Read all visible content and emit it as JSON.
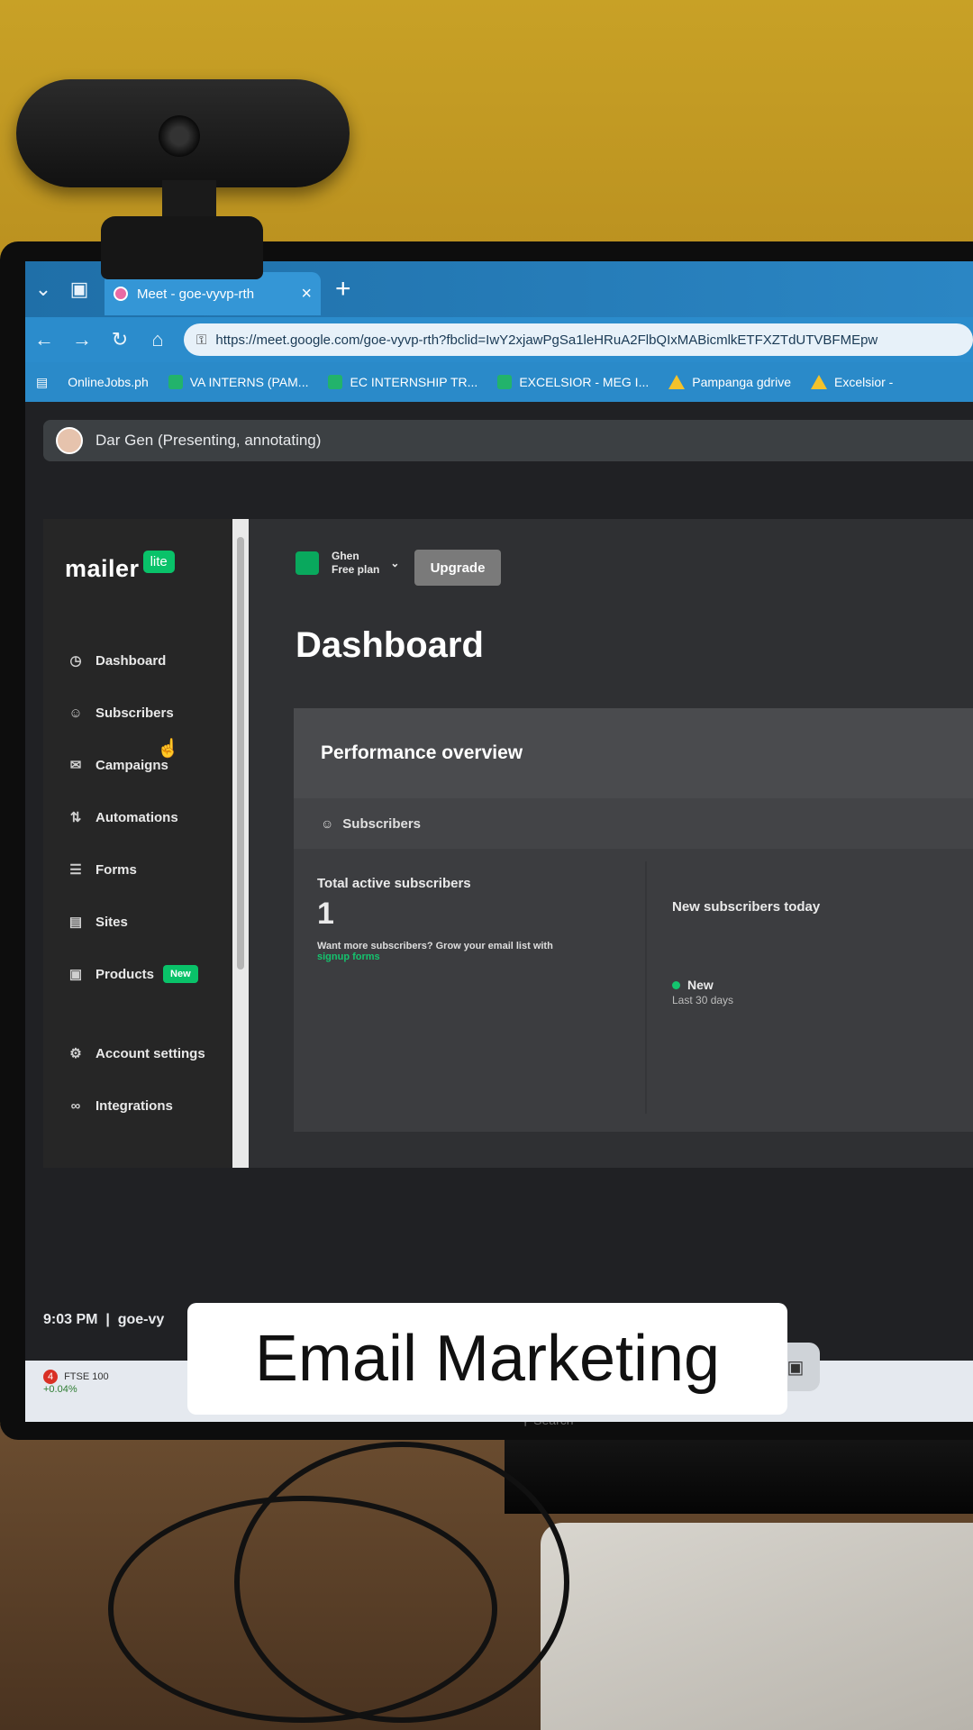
{
  "browser": {
    "tab_title": "Meet - goe-vyvp-rth",
    "url": "https://meet.google.com/goe-vyvp-rth?fbclid=IwY2xjawPgSa1leHRuA2FlbQIxMABicmlkETFXZTdUTVBFMEpw",
    "bookmarks": [
      "OnlineJobs.ph",
      "VA INTERNS (PAM...",
      "EC INTERNSHIP TR...",
      "EXCELSIOR - MEG I...",
      "Pampanga gdrive",
      "Excelsior -"
    ]
  },
  "meet": {
    "presenter": "Dar Gen (Presenting, annotating)",
    "time": "9:03 PM",
    "code": "goe-vy"
  },
  "app": {
    "logo_word": "mailer",
    "logo_badge": "lite",
    "account_name": "Ghen",
    "account_plan": "Free plan",
    "upgrade_label": "Upgrade",
    "page_title": "Dashboard",
    "nav": [
      {
        "label": "Dashboard",
        "icon": "clock-icon"
      },
      {
        "label": "Subscribers",
        "icon": "person-icon"
      },
      {
        "label": "Campaigns",
        "icon": "envelope-icon"
      },
      {
        "label": "Automations",
        "icon": "automation-icon"
      },
      {
        "label": "Forms",
        "icon": "layers-icon"
      },
      {
        "label": "Sites",
        "icon": "window-icon"
      },
      {
        "label": "Products",
        "icon": "bag-icon",
        "badge": "New"
      },
      {
        "label": "Account settings",
        "icon": "gear-icon"
      },
      {
        "label": "Integrations",
        "icon": "link-icon"
      }
    ],
    "performance": {
      "title": "Performance overview",
      "tab": "Subscribers",
      "total_label": "Total active subscribers",
      "total_value": "1",
      "hint": "Want more subscribers? Grow your email list with",
      "hint_link": "signup forms",
      "new_today_label": "New subscribers today",
      "legend_label": "New",
      "legend_sub": "Last 30 days"
    }
  },
  "taskbar": {
    "stock_name": "FTSE 100",
    "stock_change": "+0.04%",
    "stock_badge": "4",
    "search_label": "Search"
  },
  "caption": "Email Marketing"
}
